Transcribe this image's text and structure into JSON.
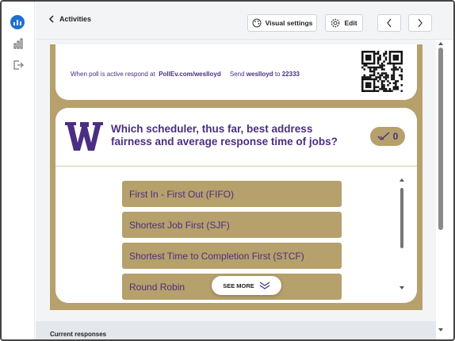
{
  "header": {
    "back_label": "Activities",
    "visual_settings_label": "Visual settings",
    "edit_label": "Edit"
  },
  "instructions": {
    "prefix": "When poll is active respond at",
    "url": "PollEv.com/weslloyd",
    "send": "Send",
    "keyword": "weslloyd",
    "to": "to",
    "number": "22333"
  },
  "question": {
    "text": "Which scheduler, thus far, best address fairness and average response time of jobs?",
    "vote_count": "0"
  },
  "options": [
    {
      "label": "First In - First Out (FIFO)"
    },
    {
      "label": "Shortest Job First (SJF)"
    },
    {
      "label": "Shortest Time to Completion First (STCF)"
    },
    {
      "label": "Round Robin"
    }
  ],
  "see_more_label": "SEE MORE",
  "footer": {
    "label": "Current responses"
  },
  "colors": {
    "accent_blue": "#1f6fd1",
    "uw_purple": "#4b2e83",
    "uw_gold": "#b6a06b"
  },
  "icons": {
    "logo": "poll-everywhere-logo",
    "nav1": "bar-chart-icon",
    "nav2": "sign-out-icon",
    "back": "chevron-left-icon",
    "visual": "palette-icon",
    "edit": "gear-icon",
    "prev": "chevron-left-icon",
    "next": "chevron-right-icon",
    "votes": "check-icon",
    "see_more": "chevron-double-down-icon"
  }
}
